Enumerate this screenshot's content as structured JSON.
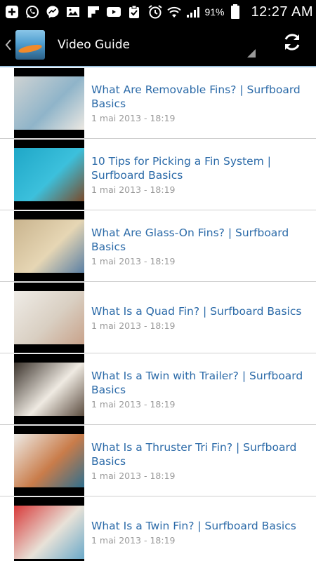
{
  "status_bar": {
    "icons": [
      "add-icon",
      "whatsapp-icon",
      "messenger-icon",
      "gallery-icon",
      "flipboard-icon",
      "youtube-icon",
      "clipboard-icon",
      "alarm-icon",
      "wifi-icon",
      "signal-icon",
      "battery-icon"
    ],
    "battery_percent": "91%",
    "time": "12:27 AM"
  },
  "action_bar": {
    "title": "Video Guide",
    "back_icon": "chevron-left-icon",
    "refresh_icon": "refresh-icon"
  },
  "videos": [
    {
      "title": "What Are Removable Fins? | Surfboard Basics",
      "date": "1 mai 2013 - 18:19",
      "thumb_colors": [
        "#cfd3d3",
        "#8fb4c9",
        "#ece8e2"
      ]
    },
    {
      "title": "10 Tips for Picking a Fin System | Surfboard Basics",
      "date": "1 mai 2013 - 18:19",
      "thumb_colors": [
        "#1fa7c7",
        "#3cc0dc",
        "#7a4a2a"
      ]
    },
    {
      "title": "What Are Glass-On Fins? | Surfboard Basics",
      "date": "1 mai 2013 - 18:19",
      "thumb_colors": [
        "#c9b48e",
        "#e6d6b4",
        "#5a7fa4"
      ]
    },
    {
      "title": "What Is a Quad Fin? | Surfboard Basics",
      "date": "1 mai 2013 - 18:19",
      "thumb_colors": [
        "#efece7",
        "#d9cfc2",
        "#c8a28a"
      ]
    },
    {
      "title": "What Is a Twin with Trailer? | Surfboard Basics",
      "date": "1 mai 2013 - 18:19",
      "thumb_colors": [
        "#3b332c",
        "#efeae2",
        "#5c4d40"
      ]
    },
    {
      "title": "What Is a Thruster Tri Fin? | Surfboard Basics",
      "date": "1 mai 2013 - 18:19",
      "thumb_colors": [
        "#eeebe6",
        "#c97c4a",
        "#2f6f8e"
      ]
    },
    {
      "title": "What Is a Twin Fin? | Surfboard Basics",
      "date": "1 mai 2013 - 18:19",
      "thumb_colors": [
        "#d83a3a",
        "#e8e2d8",
        "#6aa9c9"
      ]
    }
  ]
}
